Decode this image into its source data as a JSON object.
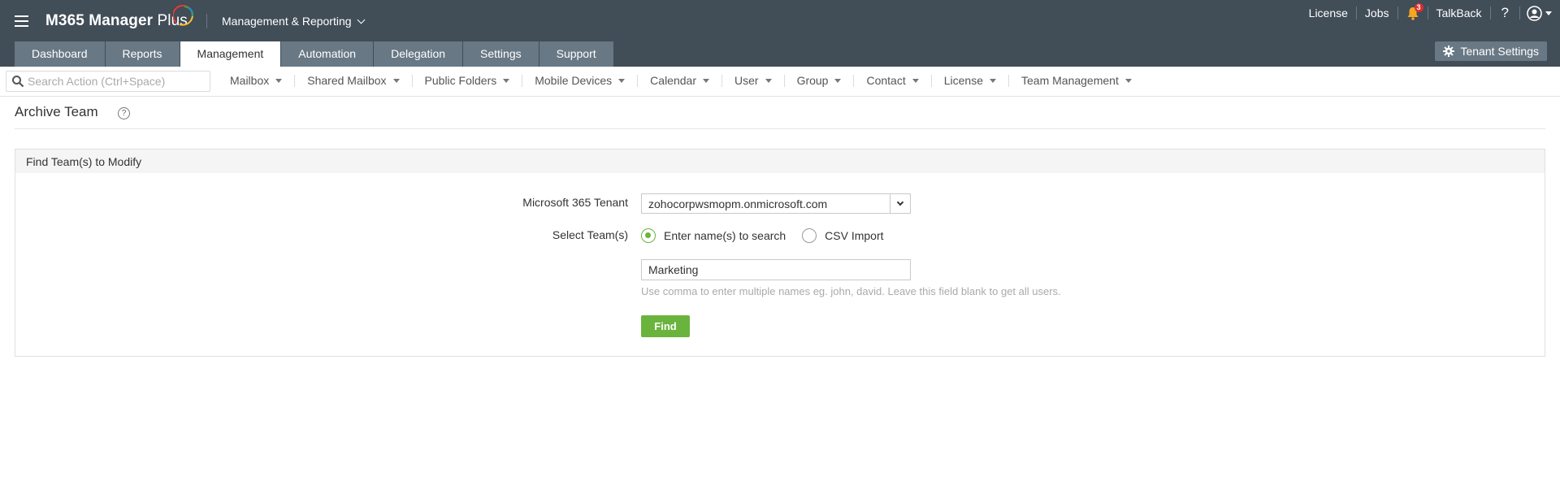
{
  "app": {
    "name_main": "M365 Manager ",
    "name_suffix": "Plus",
    "product_menu": "Management & Reporting"
  },
  "header_right": {
    "license": "License",
    "jobs": "Jobs",
    "notification_count": "3",
    "talkback": "TalkBack",
    "help": "?"
  },
  "tabs": [
    {
      "label": "Dashboard",
      "active": false
    },
    {
      "label": "Reports",
      "active": false
    },
    {
      "label": "Management",
      "active": true
    },
    {
      "label": "Automation",
      "active": false
    },
    {
      "label": "Delegation",
      "active": false
    },
    {
      "label": "Settings",
      "active": false
    },
    {
      "label": "Support",
      "active": false
    }
  ],
  "tenant_settings": "Tenant Settings",
  "search": {
    "placeholder": "Search Action (Ctrl+Space)"
  },
  "action_menu": [
    "Mailbox",
    "Shared Mailbox",
    "Public Folders",
    "Mobile Devices",
    "Calendar",
    "User",
    "Group",
    "Contact",
    "License",
    "Team Management"
  ],
  "page": {
    "title": "Archive Team",
    "help_icon": "?"
  },
  "panel": {
    "title": "Find Team(s) to Modify",
    "tenant_label": "Microsoft 365 Tenant",
    "tenant_value": "zohocorpwsmopm.onmicrosoft.com",
    "select_label": "Select Team(s)",
    "radio_search": "Enter name(s) to search",
    "radio_csv": "CSV Import",
    "selected_option": "search",
    "name_value": "Marketing",
    "hint": "Use comma to enter multiple names eg. john, david. Leave this field blank to get all users.",
    "find_button": "Find"
  },
  "colors": {
    "header_bg": "#414d57",
    "tab_bg": "#687884",
    "accent_green": "#6ab43e",
    "badge_red": "#e02d2d"
  }
}
